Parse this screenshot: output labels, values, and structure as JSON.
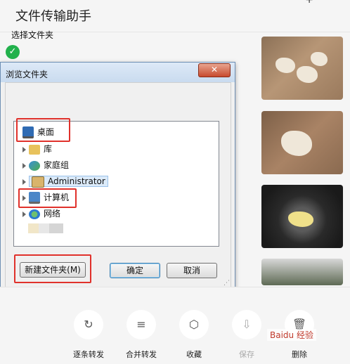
{
  "app": {
    "title": "文件传输助手",
    "plus_icon": "+"
  },
  "status": {
    "check_icon": "✓",
    "check_color": "#22b14c"
  },
  "chat": {
    "thumbnails": [
      "garlic-cloves-photo",
      "minced-garlic-photo",
      "garlic-in-wok-photo",
      "greens-in-colander-photo"
    ]
  },
  "dialog": {
    "title": "浏览文件夹",
    "close_icon": "✕",
    "prompt": "选择文件夹",
    "tree": [
      {
        "label": "桌面",
        "icon": "desktop-icon"
      },
      {
        "label": "库",
        "icon": "library-icon"
      },
      {
        "label": "家庭组",
        "icon": "homegroup-icon"
      },
      {
        "label": "Administrator",
        "icon": "user-folder-icon"
      },
      {
        "label": "计算机",
        "icon": "computer-icon"
      },
      {
        "label": "网络",
        "icon": "network-icon"
      }
    ],
    "buttons": {
      "new_folder": "新建文件夹(M)",
      "ok": "确定",
      "cancel": "取消"
    },
    "highlight_color": "#e0312b"
  },
  "actions": [
    {
      "label": "逐条转发",
      "icon": "forward-icon"
    },
    {
      "label": "合并转发",
      "icon": "merge-forward-icon"
    },
    {
      "label": "收藏",
      "icon": "favorite-icon"
    },
    {
      "label": "保存",
      "icon": "save-icon"
    },
    {
      "label": "删除",
      "icon": "delete-icon"
    }
  ],
  "watermark": "Baidu 经验"
}
